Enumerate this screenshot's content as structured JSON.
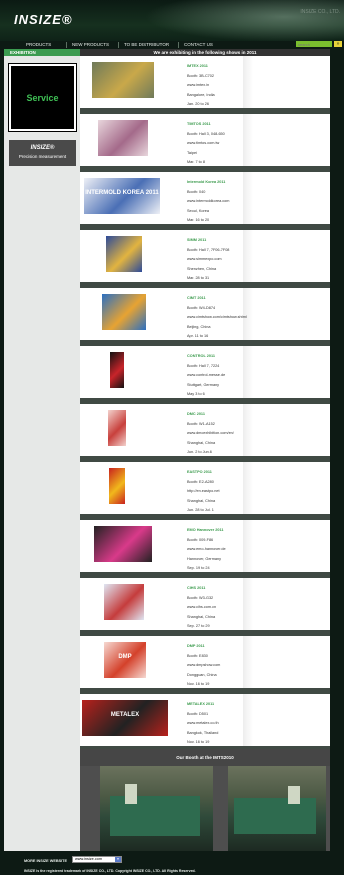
{
  "header": {
    "logo": "INSIZE®",
    "tagline": "INSIZE CO., LTD."
  },
  "nav": {
    "items": [
      {
        "label": "PRODUCTS"
      },
      {
        "label": "NEW PRODUCTS"
      },
      {
        "label": "TO BE DISTRIBUTOR"
      },
      {
        "label": "CONTACT US"
      }
    ],
    "search_placeholder": "search",
    "search_button": "»"
  },
  "sidebar": {
    "heading": "EXHIBITION",
    "service_label": "Service",
    "pm_logo": "INSIZE®",
    "pm_label": "Precision measurement"
  },
  "main": {
    "heading": "We are exhibiting in the following shows in 2011"
  },
  "shows": [
    {
      "title": "IMTEX 2011",
      "booth": "Booth: 3B-C702",
      "url": "www.imtex.in",
      "city": "Bangalore, India",
      "date": "Jan. 20 to 26"
    },
    {
      "title": "TIMTOS 2011",
      "booth": "Booth: Hall 3, 048-650",
      "url": "www.timtos.com.tw",
      "city": "Taipei",
      "date": "Mar. 7 to 8"
    },
    {
      "title": "Intermold Korea 2011",
      "booth": "Booth: 040",
      "url": "www.intermoldkorea.com",
      "city": "Seoul, Korea",
      "date": "Mar. 16 to 20"
    },
    {
      "title": "SIMM 2011",
      "booth": "Booth: Hall 7, 7F06-7F08",
      "url": "www.simmexpo.com",
      "city": "Shenzhen, China",
      "date": "Mar. 28 to 31"
    },
    {
      "title": "CIMT 2011",
      "booth": "Booth: W4-D874",
      "url": "www.cimtshow.com/cimtshow.shtml",
      "city": "Beijing, China",
      "date": "Apr. 11 to 16"
    },
    {
      "title": "CONTROL 2011",
      "booth": "Booth: Hall 7, 7224",
      "url": "www.control-messe.de",
      "city": "Stuttgart, Germany",
      "date": "May 3 to 6"
    },
    {
      "title": "DMC 2011",
      "booth": "Booth: W1-A152",
      "url": "www.dmcexhibition.com/en/",
      "city": "Shanghai, China",
      "date": "Jun. 2 to Jun.6"
    },
    {
      "title": "EASTPO 2011",
      "booth": "Booth: E2-A280",
      "url": "http://en.eastpo.net",
      "city": "Shanghai, China",
      "date": "Jun. 28 to Jul. 1"
    },
    {
      "title": "EMO Hannover 2011",
      "booth": "Booth: 009-F86",
      "url": "www.emo-hannover.de",
      "city": "Hannover, Germany",
      "date": "Sep. 19 to 24"
    },
    {
      "title": "CIHS 2011",
      "booth": "Booth: W3-G32",
      "url": "www.cihs.com.cn",
      "city": "Shanghai, China",
      "date": "Sep. 27 to 29"
    },
    {
      "title": "DMP 2011",
      "booth": "Booth: E830",
      "url": "www.dmpshow.com",
      "city": "Dongguan, China",
      "date": "Nov. 16 to 19"
    },
    {
      "title": "METALEX 2011",
      "booth": "Booth: D501",
      "url": "www.metalex.co.th",
      "city": "Bangkok, Thailand",
      "date": "Nov. 16 to 19"
    }
  ],
  "thumbs": [
    {
      "name": "imtex-logo",
      "c1": "#6f7a5a",
      "c2": "#c9a84a",
      "text": ""
    },
    {
      "name": "timtos-logo",
      "c1": "#e8d6dc",
      "c2": "#a46a8a",
      "text": ""
    },
    {
      "name": "intermold-logo",
      "c1": "#eef0f6",
      "c2": "#4a6fb5",
      "text": "INTERMOLD KOREA 2011"
    },
    {
      "name": "simm-logo",
      "c1": "#2c4a9a",
      "c2": "#e2b440",
      "text": ""
    },
    {
      "name": "cimt-logo",
      "c1": "#2a6fc2",
      "c2": "#e7a332",
      "text": ""
    },
    {
      "name": "control-logo",
      "c1": "#111111",
      "c2": "#c8242a",
      "text": ""
    },
    {
      "name": "dmc-logo",
      "c1": "#f3d2cd",
      "c2": "#c8403c",
      "text": ""
    },
    {
      "name": "eastpo-logo",
      "c1": "#c8211e",
      "c2": "#f1b81c",
      "text": ""
    },
    {
      "name": "emo-logo",
      "c1": "#222222",
      "c2": "#d93a8a",
      "text": ""
    },
    {
      "name": "cihs-logo",
      "c1": "#dfe6f3",
      "c2": "#c53c3c",
      "text": ""
    },
    {
      "name": "dmp-logo",
      "c1": "#f6d9d2",
      "c2": "#d4412b",
      "text": "DMP"
    },
    {
      "name": "metalex-logo",
      "c1": "#b8211c",
      "c2": "#222222",
      "text": "METALEX"
    }
  ],
  "booth_section": {
    "title": "Our Booth at the IMTS2010"
  },
  "footer": {
    "more_label": "MORE INSIZE WEBSITE",
    "select_value": "www.insize.com",
    "copyright": "INSIZE is the registered trademark of INSIZE CO., LTD. Copyright INSIZE CO., LTD. All Rights Reserved."
  }
}
